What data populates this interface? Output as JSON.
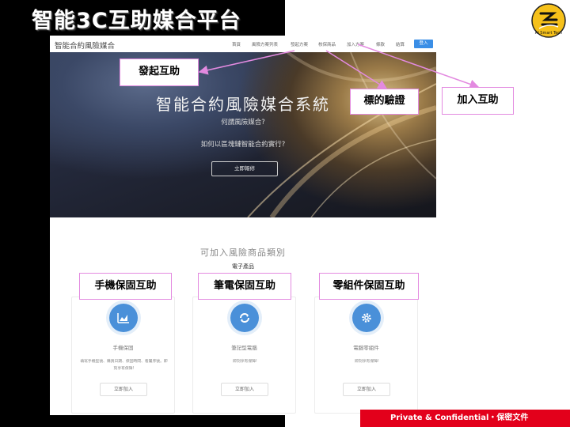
{
  "slide": {
    "title": "智能3C互助媒合平台",
    "footer": "Private & Confidential・保密文件",
    "logo_text": "AI Smart Tech"
  },
  "site": {
    "logo": "智能合約風險媒合",
    "nav": [
      "首頁",
      "風險方案列表",
      "發起方案",
      "核保商品",
      "加入方案",
      "條款",
      "結算"
    ],
    "login": "登入"
  },
  "hero": {
    "title": "智能合約風險媒合系統",
    "question1": "何謂風險媒合?",
    "question2": "如何以區塊鏈智能合約實行?",
    "button": "立即報修"
  },
  "categories": {
    "title": "可加入風險商品類別",
    "subtitle": "電子產品",
    "cards": [
      {
        "icon": "chart-icon",
        "name": "手機保固",
        "desc": "填寫手機型號、購買日期、保固時間、看屬序號。即刻享有保障!",
        "button": "立即加入"
      },
      {
        "icon": "refresh-icon",
        "name": "筆記型電腦",
        "desc": "即刻享有保障!",
        "button": "立即加入"
      },
      {
        "icon": "gear-icon",
        "name": "電腦零組件",
        "desc": "即刻享有保障!",
        "button": "立即加入"
      }
    ]
  },
  "annotations": {
    "initiate": "發起互助",
    "verify": "標的驗證",
    "join": "加入互助",
    "phone": "手機保固互助",
    "laptop": "筆電保固互助",
    "parts": "零組件保固互助"
  },
  "colors": {
    "annotation_border": "#e38ae0",
    "accent_blue": "#4a90d9",
    "footer_red": "#e3001b"
  }
}
